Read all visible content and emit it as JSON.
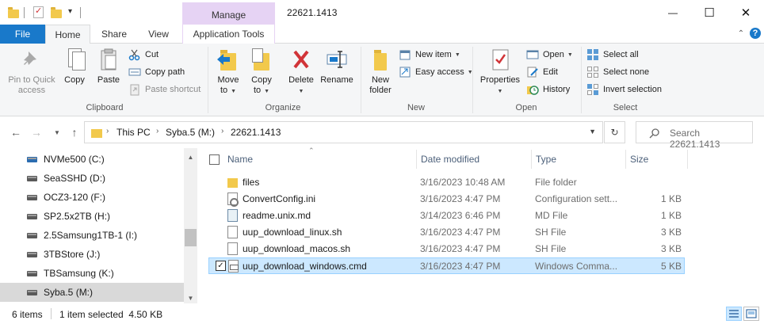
{
  "window": {
    "title": "22621.1413",
    "context_tab": "Manage",
    "minimize_icon": "—",
    "maximize_icon": "☐",
    "close_icon": "✕"
  },
  "ribbon_tabs": {
    "file": "File",
    "home": "Home",
    "share": "Share",
    "view": "View",
    "application_tools": "Application Tools"
  },
  "ribbon": {
    "clipboard": {
      "label": "Clipboard",
      "pin": "Pin to Quick access",
      "pin_line1": "Pin to Quick",
      "pin_line2": "access",
      "copy": "Copy",
      "paste": "Paste",
      "cut": "Cut",
      "copy_path": "Copy path",
      "paste_shortcut": "Paste shortcut"
    },
    "organize": {
      "label": "Organize",
      "move_to": "Move to",
      "move_line1": "Move",
      "move_line2": "to",
      "copy_to": "Copy to",
      "copy_line1": "Copy",
      "copy_line2": "to",
      "delete": "Delete",
      "rename": "Rename"
    },
    "new": {
      "label": "New",
      "new_folder_line1": "New",
      "new_folder_line2": "folder",
      "new_item": "New item",
      "easy_access": "Easy access"
    },
    "open": {
      "label": "Open",
      "properties": "Properties",
      "open": "Open",
      "edit": "Edit",
      "history": "History"
    },
    "select": {
      "label": "Select",
      "select_all": "Select all",
      "select_none": "Select none",
      "invert_selection": "Invert selection"
    }
  },
  "address": {
    "crumbs": [
      "This PC",
      "Syba.5 (M:)",
      "22621.1413"
    ],
    "search_placeholder": "Search 22621.1413"
  },
  "nav_pane": {
    "items": [
      {
        "label": "NVMe500 (C:)"
      },
      {
        "label": "SeaSSHD (D:)"
      },
      {
        "label": "OCZ3-120 (F:)"
      },
      {
        "label": "SP2.5x2TB (H:)"
      },
      {
        "label": "2.5Samsung1TB-1 (I:)"
      },
      {
        "label": "3TBStore (J:)"
      },
      {
        "label": "TBSamsung (K:)"
      },
      {
        "label": "Syba.5 (M:)"
      }
    ]
  },
  "file_list": {
    "columns": {
      "name": "Name",
      "date": "Date modified",
      "type": "Type",
      "size": "Size"
    },
    "rows": [
      {
        "name": "files",
        "date": "3/16/2023 10:48 AM",
        "type": "File folder",
        "size": "",
        "icon": "folder-icon"
      },
      {
        "name": "ConvertConfig.ini",
        "date": "3/16/2023 4:47 PM",
        "type": "Configuration sett...",
        "size": "1 KB",
        "icon": "ini-file-icon"
      },
      {
        "name": "readme.unix.md",
        "date": "3/14/2023 6:46 PM",
        "type": "MD File",
        "size": "1 KB",
        "icon": "md-file-icon"
      },
      {
        "name": "uup_download_linux.sh",
        "date": "3/16/2023 4:47 PM",
        "type": "SH File",
        "size": "3 KB",
        "icon": "sh-file-icon"
      },
      {
        "name": "uup_download_macos.sh",
        "date": "3/16/2023 4:47 PM",
        "type": "SH File",
        "size": "3 KB",
        "icon": "sh-file-icon"
      },
      {
        "name": "uup_download_windows.cmd",
        "date": "3/16/2023 4:47 PM",
        "type": "Windows Comma...",
        "size": "5 KB",
        "icon": "cmd-file-icon"
      }
    ]
  },
  "status": {
    "item_count": "6 items",
    "selection": "1 item selected  4.50 KB"
  },
  "colors": {
    "file_tab": "#1979ca",
    "manage_tab": "#e6d3f4",
    "selection": "#cce8ff",
    "folder": "#f2c94c"
  }
}
